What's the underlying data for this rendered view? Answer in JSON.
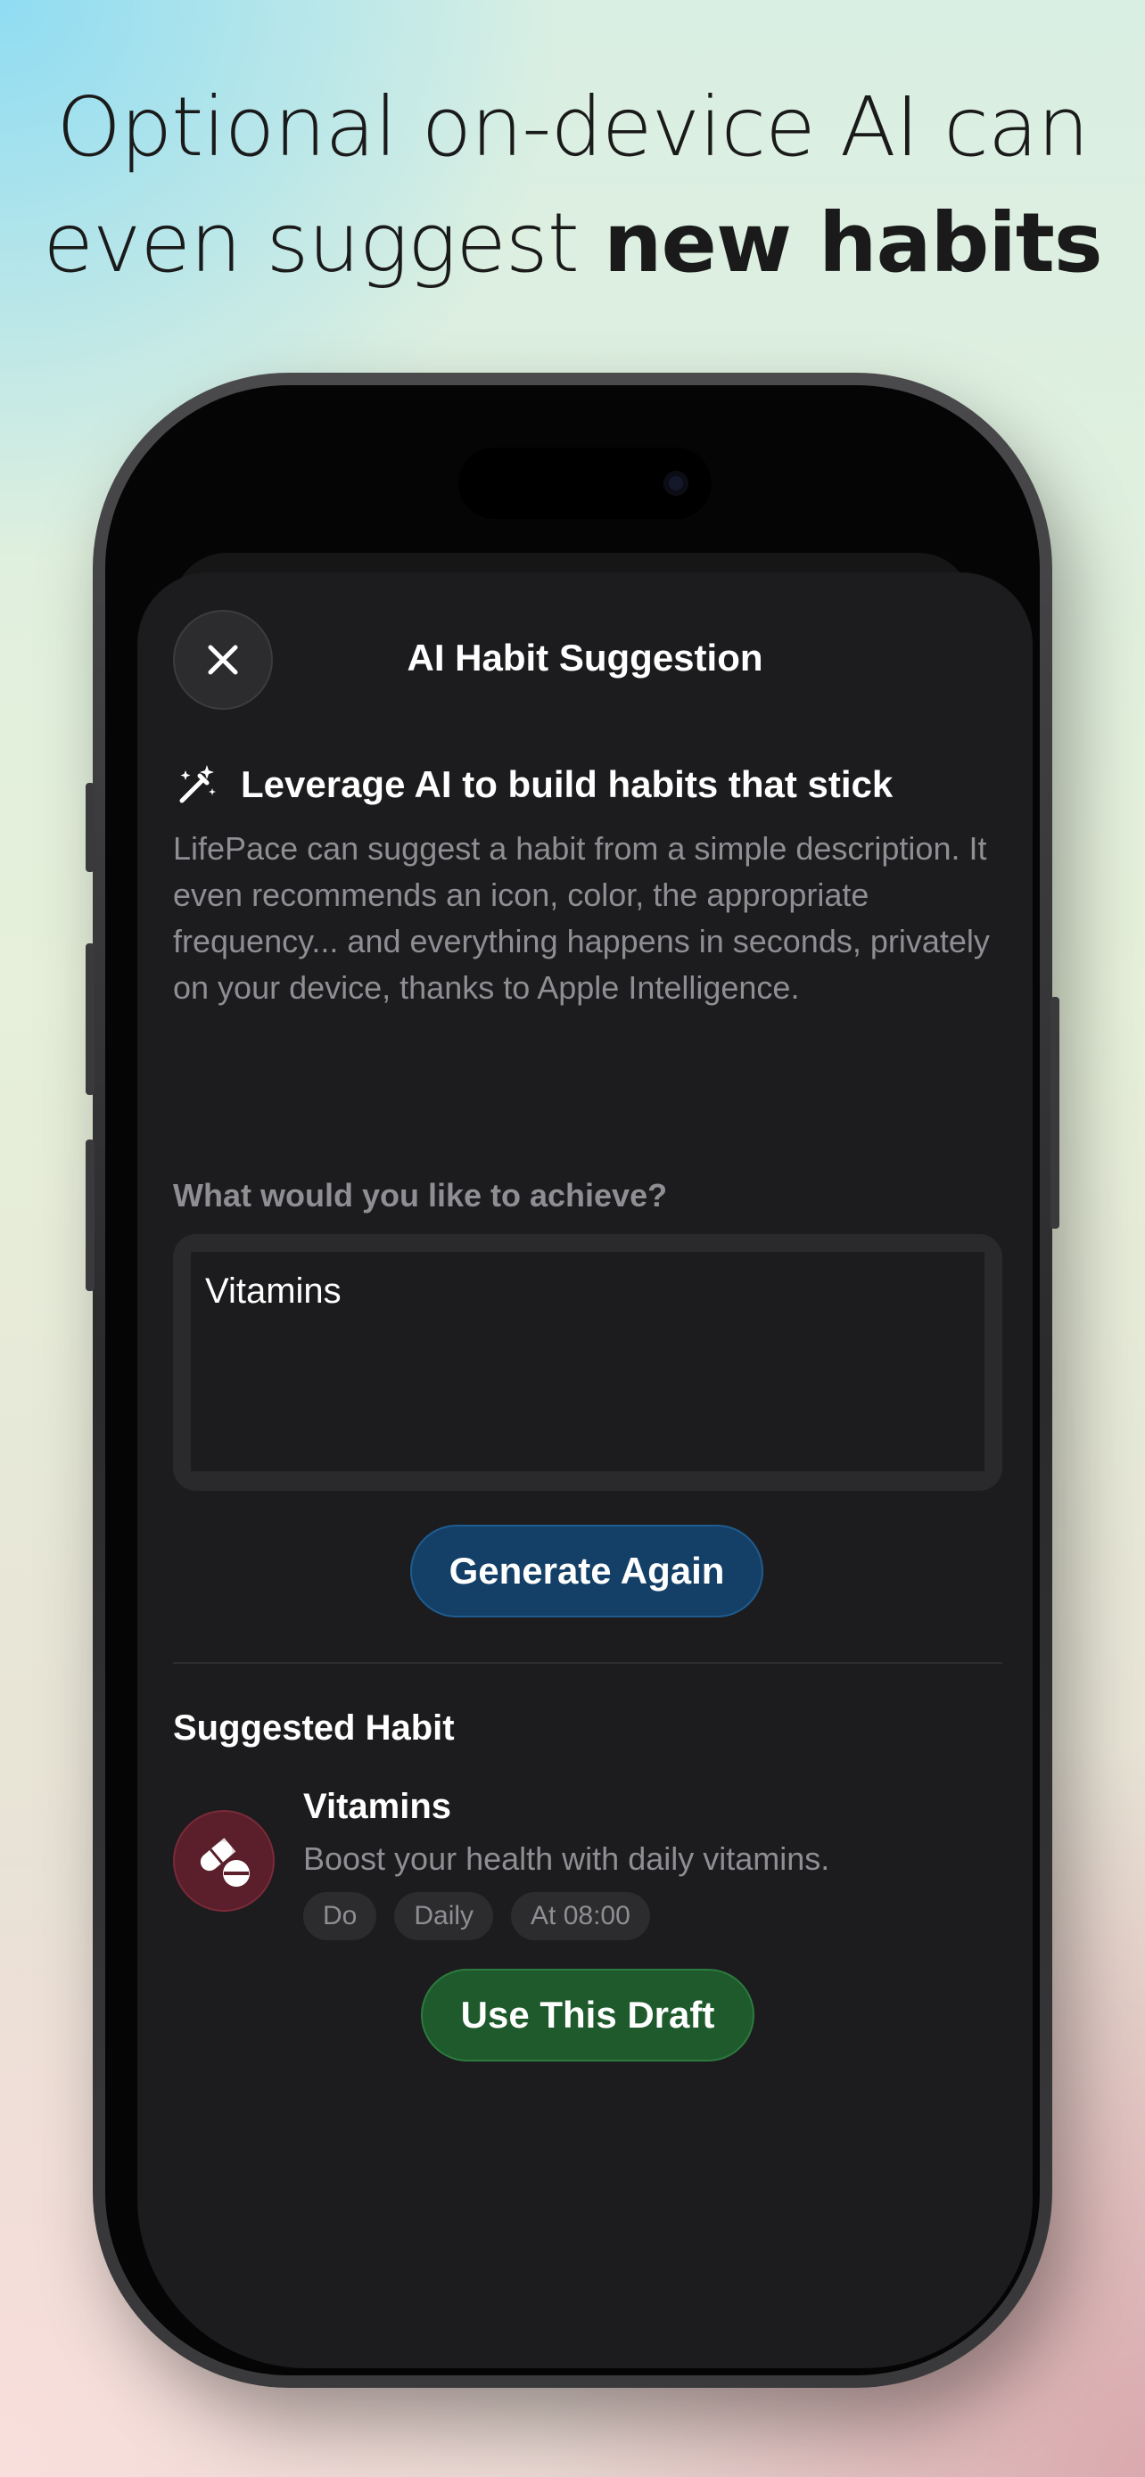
{
  "headline": {
    "line1": "Optional on-device AI can",
    "line2_regular": "even suggest ",
    "line2_bold": "new habits"
  },
  "sheet": {
    "title": "AI Habit Suggestion",
    "close_icon": "xmark-icon",
    "intro": {
      "icon": "magic-wand-icon",
      "title": "Leverage AI to build habits that stick",
      "description": "LifePace can suggest a habit from a simple description. It even recommends an icon, color, the appropriate frequency... and everything happens in seconds, privately on your device, thanks to Apple Intelligence."
    },
    "input": {
      "label": "What would you like to achieve?",
      "value": "Vitamins"
    },
    "generate_label": "Generate Again",
    "suggested": {
      "heading": "Suggested Habit",
      "icon": "pills-icon",
      "name": "Vitamins",
      "description": "Boost your health with daily vitamins.",
      "tags": [
        "Do",
        "Daily",
        "At 08:00"
      ]
    },
    "use_label": "Use This Draft"
  },
  "colors": {
    "generate": "#143f66",
    "use": "#1e5a2c",
    "habit_icon_bg": "#5a1f2a",
    "sheet_bg": "#1c1c1e"
  }
}
